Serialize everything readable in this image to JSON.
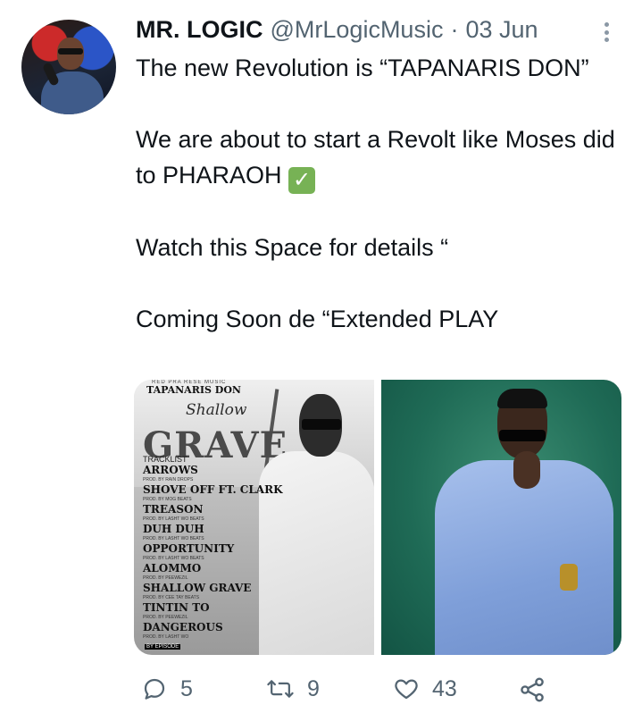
{
  "tweet": {
    "author_name": "MR. LOGIC",
    "handle": "@MrLogicMusic",
    "separator": "·",
    "date": "03 Jun",
    "lines": [
      "The new Revolution is “TAPANARIS DON”",
      "",
      "We are about to start a Revolt like Moses did to PHARAOH",
      "",
      "Watch this Space for details “",
      "",
      "Coming Soon de “Extended PLAY"
    ],
    "check_emoji": "✓"
  },
  "media": {
    "left": {
      "top_small": "RED PRA RESE MUSIC",
      "artist": "TAPANARIS DON",
      "title_small": "Shallow",
      "title_big": "GRAVE",
      "tracklist_label": "TRACKLIST",
      "tracks": [
        {
          "name": "ARROWS",
          "prod": "PROD. BY RAIN DROPS"
        },
        {
          "name": "SHOVE OFF FT. CLARK",
          "prod": "PROD. BY MOG BEATS"
        },
        {
          "name": "TREASON",
          "prod": "PROD. BY LASHT WO BEATS"
        },
        {
          "name": "DUH DUH",
          "prod": "PROD. BY LASHT WO BEATS"
        },
        {
          "name": "OPPORTUNITY",
          "prod": "PROD. BY LASHT WO BEATS"
        },
        {
          "name": "ALOMMO",
          "prod": "PROD. BY PEEWEZIL"
        },
        {
          "name": "SHALLOW GRAVE",
          "prod": "PROD. BY CEE TAY BEATS"
        },
        {
          "name": "TINTIN TO",
          "prod": "PROD. BY PEEWEZIL"
        },
        {
          "name": "DANGEROUS",
          "prod": "PROD. BY LASHT WO"
        }
      ],
      "bottom_label": "BY EPISODE"
    }
  },
  "actions": {
    "reply_count": "5",
    "retweet_count": "9",
    "like_count": "43"
  },
  "colors": {
    "text": "#0f1419",
    "secondary": "#536471",
    "check_bg": "#77b255"
  }
}
